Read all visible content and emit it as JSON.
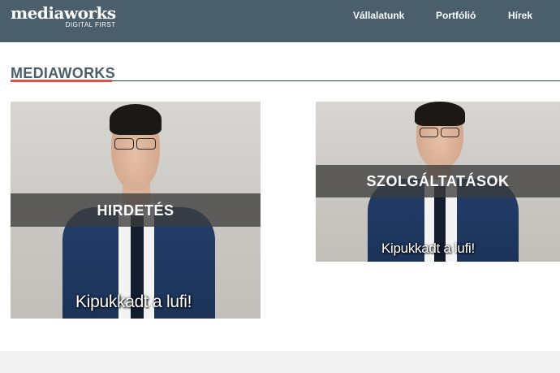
{
  "header": {
    "logo_main": "mediaworks",
    "logo_sub": "DIGITAL FIRST",
    "nav": [
      "Vállalatunk",
      "Portfólió",
      "Hírek"
    ],
    "background_color": "#4a5f6b"
  },
  "section": {
    "title": "MEDIAWORKS",
    "accent_color": "#d9534f"
  },
  "cards": [
    {
      "label": "HIRDETÉS",
      "caption": "Kipukkadt a lufi!"
    },
    {
      "label": "SZOLGÁLTATÁSOK",
      "caption": "Kipukkadt a lufi!"
    }
  ]
}
